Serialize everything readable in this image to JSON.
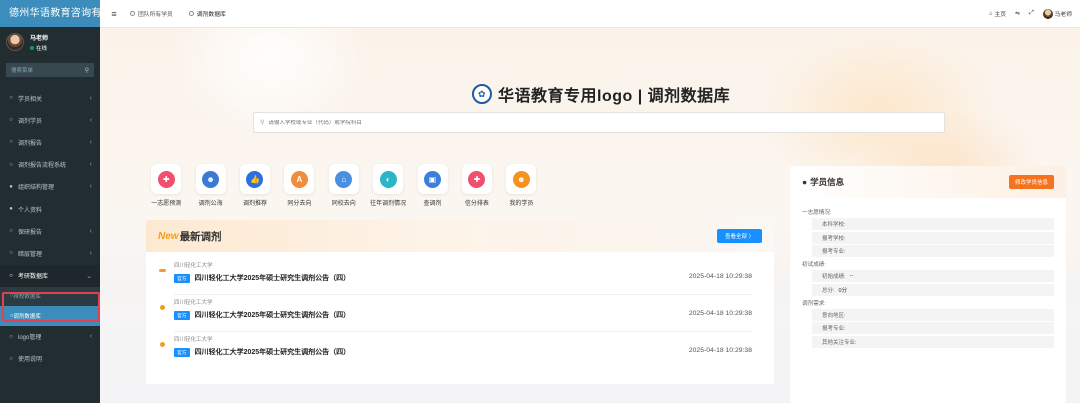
{
  "sidebar": {
    "brand": "德州华语教育咨询有",
    "user": {
      "name": "马老师",
      "status": "在线"
    },
    "search_placeholder": "搜索菜单",
    "items": [
      {
        "label": "学员相关",
        "icon": "○"
      },
      {
        "label": "调剂学员",
        "icon": "○"
      },
      {
        "label": "调剂报告",
        "icon": "○"
      },
      {
        "label": "调剂报告流程系统",
        "icon": "○"
      },
      {
        "label": "组织结构管理",
        "icon": "●"
      },
      {
        "label": "个人资料",
        "icon": "●"
      },
      {
        "label": "保研报告",
        "icon": "○"
      },
      {
        "label": "暗层管理",
        "icon": "○"
      },
      {
        "label": "考研数据库",
        "icon": "○"
      }
    ],
    "submenu": [
      {
        "label": "择校数据库"
      },
      {
        "label": "调剂数据库"
      }
    ],
    "items_after": [
      {
        "label": "logo管理",
        "icon": "○"
      },
      {
        "label": "使用说明",
        "icon": "○"
      }
    ]
  },
  "topbar": {
    "tabs": [
      {
        "label": "团队所有学员"
      },
      {
        "label": "调剂数据库"
      }
    ],
    "home": "主页",
    "user": "马老师"
  },
  "hero": {
    "title": "华语教育专用logo | 调剂数据库",
    "search_placeholder": "请输入学校或专业（代码）或学院科目"
  },
  "quick_links": [
    {
      "label": "一志愿预测",
      "color": "#f0506e",
      "glyph": "✚"
    },
    {
      "label": "调剂公海",
      "color": "#3a7bd5",
      "glyph": "☻"
    },
    {
      "label": "调剂推荐",
      "color": "#2e6fe0",
      "glyph": "👍"
    },
    {
      "label": "同分去向",
      "color": "#f08c3a",
      "glyph": "A"
    },
    {
      "label": "同校去向",
      "color": "#4a90e2",
      "glyph": "⌂"
    },
    {
      "label": "往年调剂情况",
      "color": "#2bb5c6",
      "glyph": "◐"
    },
    {
      "label": "查调剂",
      "color": "#3c7fd8",
      "glyph": "▣"
    },
    {
      "label": "信分排表",
      "color": "#f0506e",
      "glyph": "✚"
    },
    {
      "label": "我的学员",
      "color": "#f5931e",
      "glyph": "☻"
    }
  ],
  "news": {
    "new_tag": "New",
    "title": "最新调剂",
    "more": "查看全部 〉",
    "items": [
      {
        "school": "四川轻化工大学",
        "tag": "官方",
        "title": "四川轻化工大学2025年硕士研究生调剂公告（四）",
        "date": "2025-04-18 10:29:38"
      },
      {
        "school": "四川轻化工大学",
        "tag": "官方",
        "title": "四川轻化工大学2025年硕士研究生调剂公告（四）",
        "date": "2025-04-18 10:29:38"
      },
      {
        "school": "四川轻化工大学",
        "tag": "官方",
        "title": "四川轻化工大学2025年硕士研究生调剂公告（四）",
        "date": "2025-04-18 10:29:38"
      }
    ]
  },
  "student": {
    "title": "学员信息",
    "edit": "修改学员信息",
    "sections": [
      {
        "label": "一志愿情况:",
        "fields": [
          {
            "k": "本科学校:",
            "v": ""
          },
          {
            "k": "报考学校:",
            "v": ""
          },
          {
            "k": "报考专业:",
            "v": ""
          }
        ]
      },
      {
        "label": "初试成绩:",
        "fields": [
          {
            "k": "初始成绩:",
            "v": "--"
          },
          {
            "k": "总分:",
            "v": "0分"
          }
        ]
      },
      {
        "label": "调剂需求:",
        "fields": [
          {
            "k": "意向地区:",
            "v": ""
          },
          {
            "k": "报考专业:",
            "v": ""
          },
          {
            "k": "其他关注专业:",
            "v": ""
          }
        ]
      }
    ]
  }
}
